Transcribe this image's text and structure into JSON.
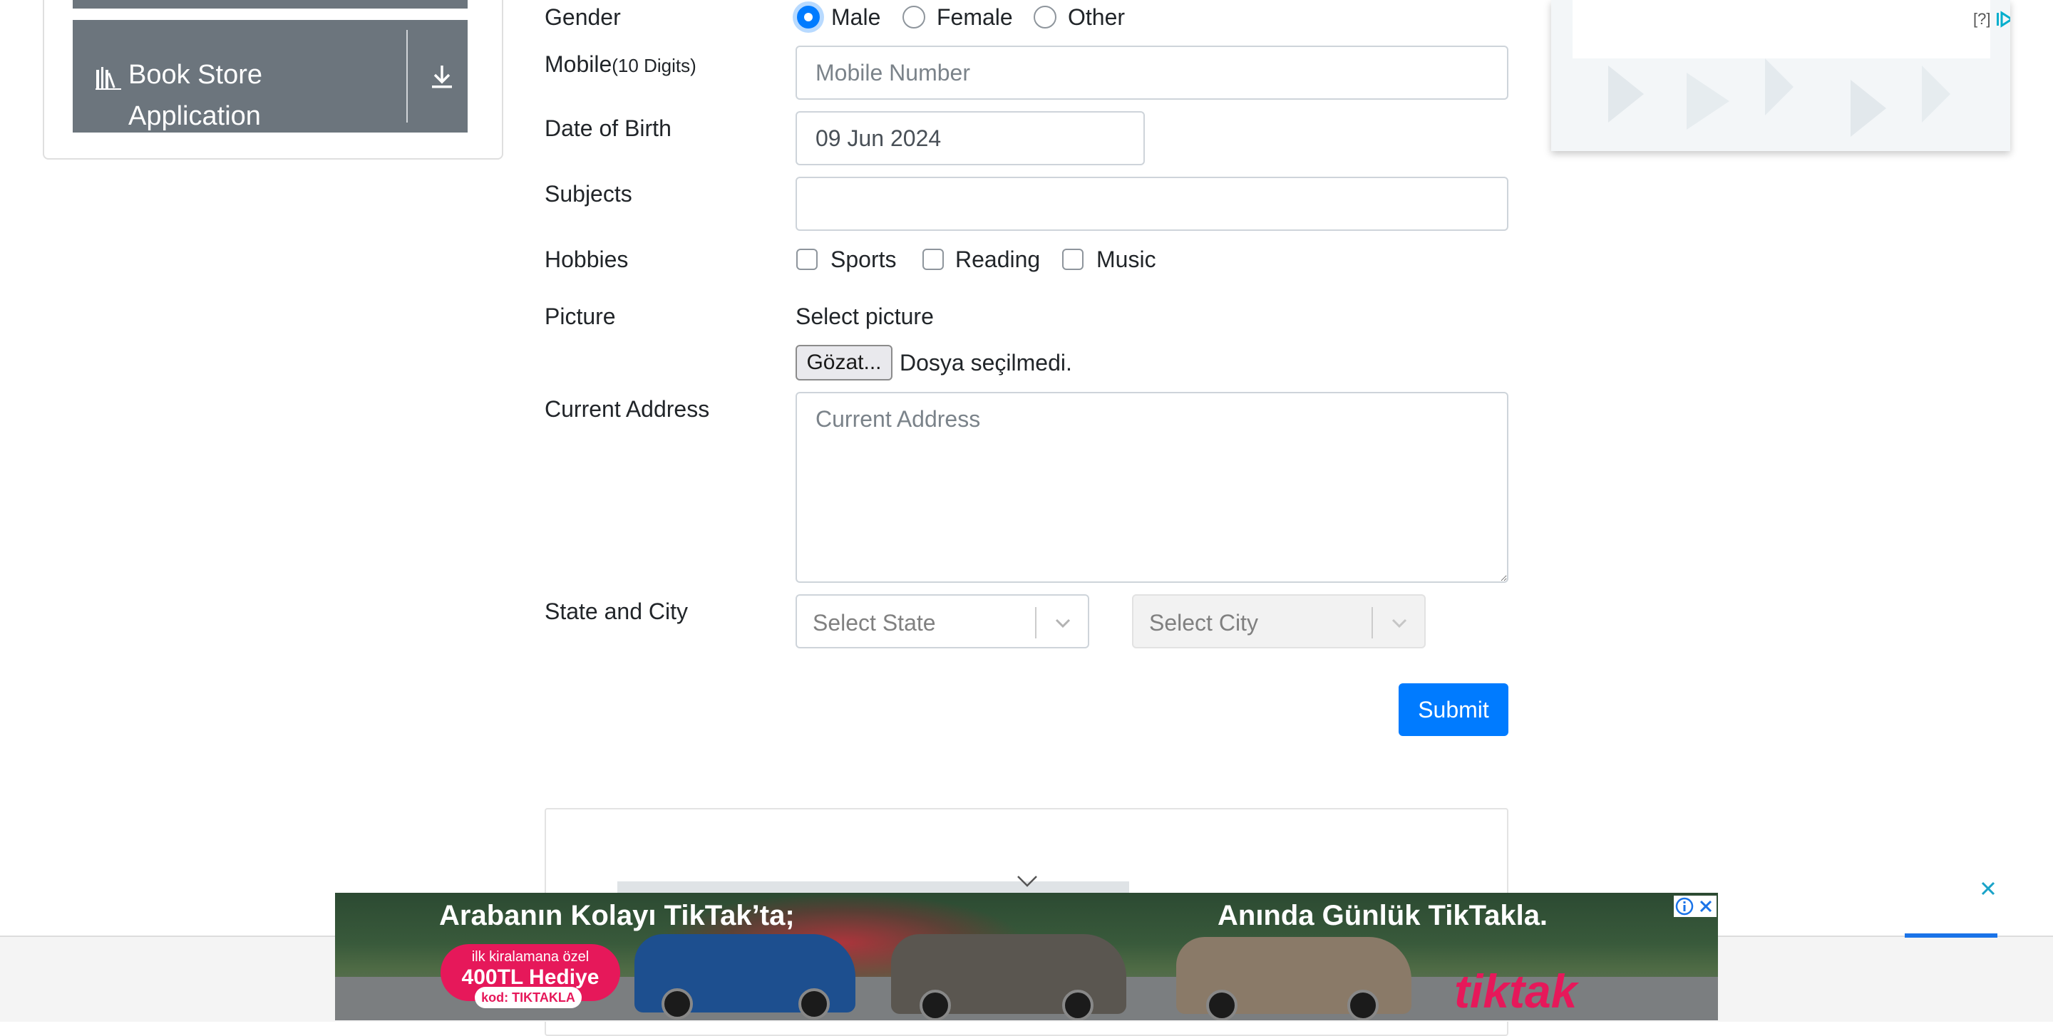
{
  "sidebar": {
    "group_label_line1": "Book Store",
    "group_label_line2": "Application"
  },
  "form": {
    "gender": {
      "label": "Gender",
      "options": [
        "Male",
        "Female",
        "Other"
      ],
      "selected": "Male"
    },
    "mobile": {
      "label": "Mobile",
      "hint": "(10 Digits)",
      "placeholder": "Mobile Number"
    },
    "dob": {
      "label": "Date of Birth",
      "value": "09 Jun 2024"
    },
    "subjects": {
      "label": "Subjects",
      "value": ""
    },
    "hobbies": {
      "label": "Hobbies",
      "options": [
        "Sports",
        "Reading",
        "Music"
      ]
    },
    "picture": {
      "label": "Picture",
      "select_text": "Select picture",
      "browse_button": "Gözat...",
      "no_file_text": "Dosya seçilmedi."
    },
    "current_address": {
      "label": "Current Address",
      "placeholder": "Current Address"
    },
    "state_city": {
      "label": "State and City",
      "state_placeholder": "Select State",
      "city_placeholder": "Select City"
    },
    "submit_label": "Submit"
  },
  "right_ad": {
    "info_text": "[?]"
  },
  "banner_ad": {
    "headline_left": "Arabanın Kolayı TikTak’ta;",
    "headline_right": "Anında Günlük TikTakla.",
    "badge_line1": "ilk kiralamana özel",
    "badge_line2": "400TL Hediye",
    "code": "kod: TIKTAKLA",
    "brand": "tiktak"
  },
  "colors": {
    "primary": "#007bff",
    "sidebar_group": "#6c757d",
    "banner_brand": "#e6185a"
  }
}
